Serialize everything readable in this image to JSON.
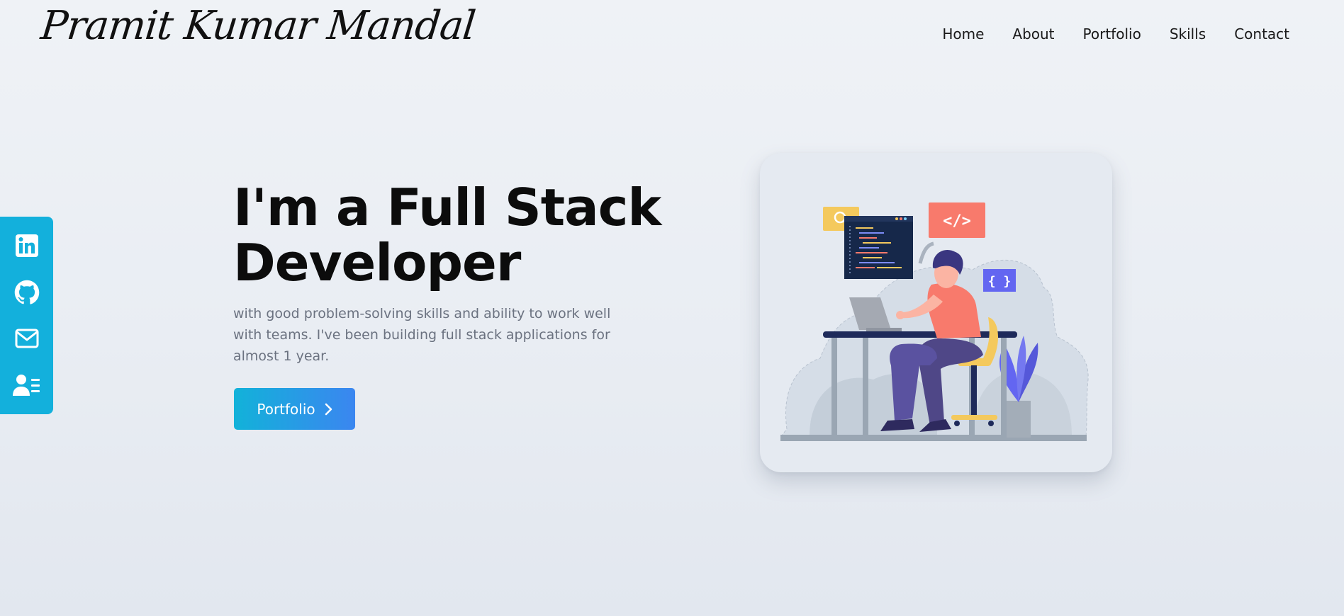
{
  "header": {
    "logo": "Pramit Kumar Mandal",
    "nav": [
      "Home",
      "About",
      "Portfolio",
      "Skills",
      "Contact"
    ]
  },
  "social": {
    "icons": [
      "linkedin-icon",
      "github-icon",
      "mail-icon",
      "contact-card-icon"
    ]
  },
  "hero": {
    "title_line1": "I'm a Full Stack",
    "title_line2": "Developer",
    "description": "with good problem-solving skills and ability to work well with teams. I've been building full stack applications for almost 1 year.",
    "button_label": "Portfolio"
  },
  "illustration": {
    "code_tag": "</>",
    "braces": "{ }"
  },
  "colors": {
    "accent_start": "#12b2d9",
    "accent_end": "#3b86f0",
    "sidebar": "#13b0dc",
    "illustration_shirt": "#f87a6c",
    "illustration_purple": "#6366f1"
  }
}
